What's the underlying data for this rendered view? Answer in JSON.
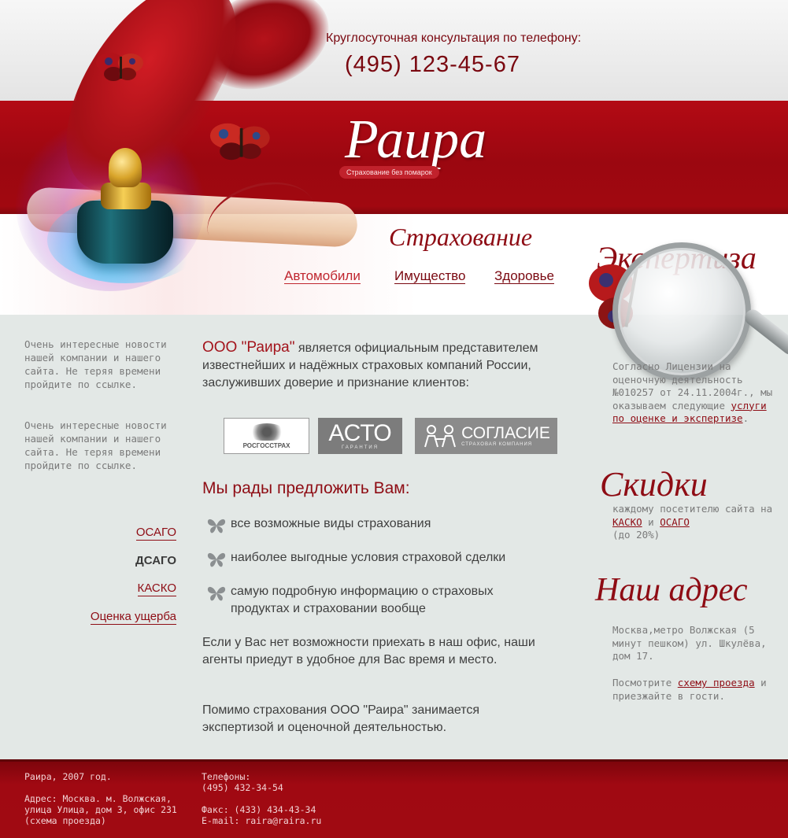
{
  "header": {
    "phone_caption": "Круглосуточная консультация  по телефону:",
    "phone_number": "(495) 123-45-67",
    "logo": "Раира",
    "tagline": "Страхование без помарок"
  },
  "insurance": {
    "title": "Страхование",
    "links": [
      "Автомобили",
      "Имущество",
      "Здоровье"
    ]
  },
  "left": {
    "news": [
      "Очень интересные новости нашей компании и нашего сайта. Не теряя времени пройдите по ссылке.",
      "Очень интересные новости нашей компании и нашего сайта. Не теряя времени пройдите по ссылке."
    ],
    "links": [
      "ОСАГО",
      "ДСАГО",
      "КАСКО",
      "Оценка ущерба"
    ]
  },
  "center": {
    "brand": "ООО \"Раира\"",
    "intro": " является официальным представителем известнейших и надёжных страховых компаний России, заслуживших доверие и признание клиентов:",
    "partners": {
      "p1": "РОСГОССТРАХ",
      "p2": "АСТО",
      "p2_sub": "ГАРАНТИЯ",
      "p3": "СОГЛАСИЕ",
      "p3_sub": "СТРАХОВАЯ КОМПАНИЯ"
    },
    "offer_title": "Мы рады предложить Вам:",
    "offer_items": [
      "все возможные виды страхования",
      "наиболее выгодные условия страховой сделки",
      "самую подробную информацию о страховых продуктах и страховании вообще"
    ],
    "para1": "Если у Вас нет возможности приехать в наш офис, наши агенты приедут  в удобное для Вас время и место.",
    "para2": "Помимо страхования ООО \"Раира\" занимается экспертизой и оценочной деятельностью."
  },
  "right": {
    "expertise_title": "Экспертиза",
    "expertise_text": "Согласно Лицензии на оценочную деятельность №010257 от 24.11.2004г., мы оказываем следующие ",
    "expertise_link": "услуги по оценке и экспертизе",
    "discounts_title": "Скидки",
    "discounts_text": "каждому посетителю сайта на ",
    "discounts_link1": "КАСКО",
    "discounts_and": " и ",
    "discounts_link2": "ОСАГО",
    "discounts_tail": "(до 20%)",
    "address_title": "Наш адрес",
    "address_text": "Москва,метро Волжская (5 минут пешком) ул. Шкулёва, дом 17.",
    "directions_pre": "Посмотрите ",
    "directions_link": "схему проезда",
    "directions_post": " и приезжайте в гости."
  },
  "footer": {
    "copyright": "Раира, 2007 год.",
    "address1": "Адрес: Москва. м. Волжская,",
    "address2": "улица Улица, дом 3, офис 231",
    "address3": "(схема проезда)",
    "phones_label": "Телефоны:",
    "phones": "(495) 432-34-54",
    "fax": "Факс: (433) 434-43-34",
    "email": "E-mail: raira@raira.ru"
  },
  "colors": {
    "brand_red": "#8e0c14",
    "header_red": "#a20810",
    "body_bg": "#e3e8e6"
  }
}
